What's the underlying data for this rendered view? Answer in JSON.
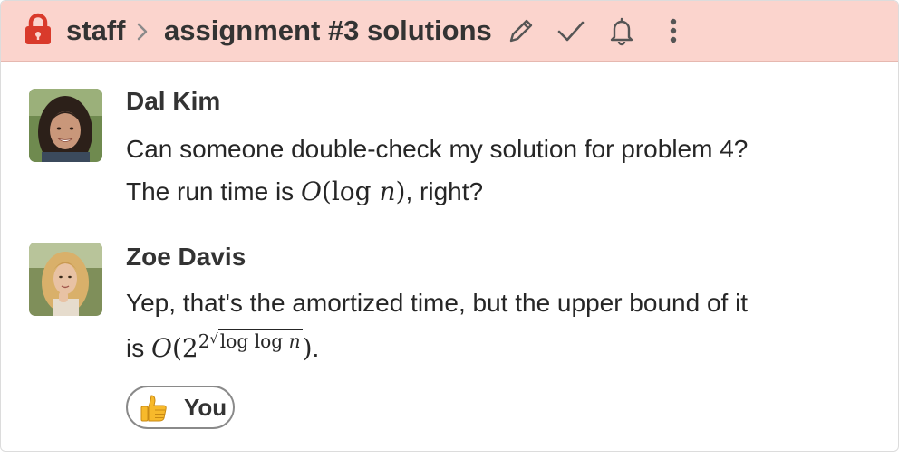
{
  "header": {
    "stream": "staff",
    "topic": "assignment #3 solutions",
    "icons": [
      "lock-icon",
      "chevron-right-icon",
      "pencil-icon",
      "checkmark-icon",
      "bell-icon",
      "more-vertical-icon"
    ]
  },
  "messages": [
    {
      "sender": "Dal Kim",
      "line1": "Can someone double-check my solution for problem 4?",
      "line2_prefix": "The run time is ",
      "line2_math": "O(log n)",
      "line2_suffix": ", right?"
    },
    {
      "sender": "Zoe Davis",
      "line1": "Yep, that's the amortized time, but the upper bound of it",
      "line2_prefix": "is ",
      "line2_math": "O(2^(2√(log log n)))",
      "line2_suffix": "."
    }
  ],
  "reaction": {
    "emoji": "thumbs-up-icon",
    "label": "You"
  },
  "colors": {
    "header_bg": "#fbd4cd",
    "lock": "#d93a2b"
  }
}
